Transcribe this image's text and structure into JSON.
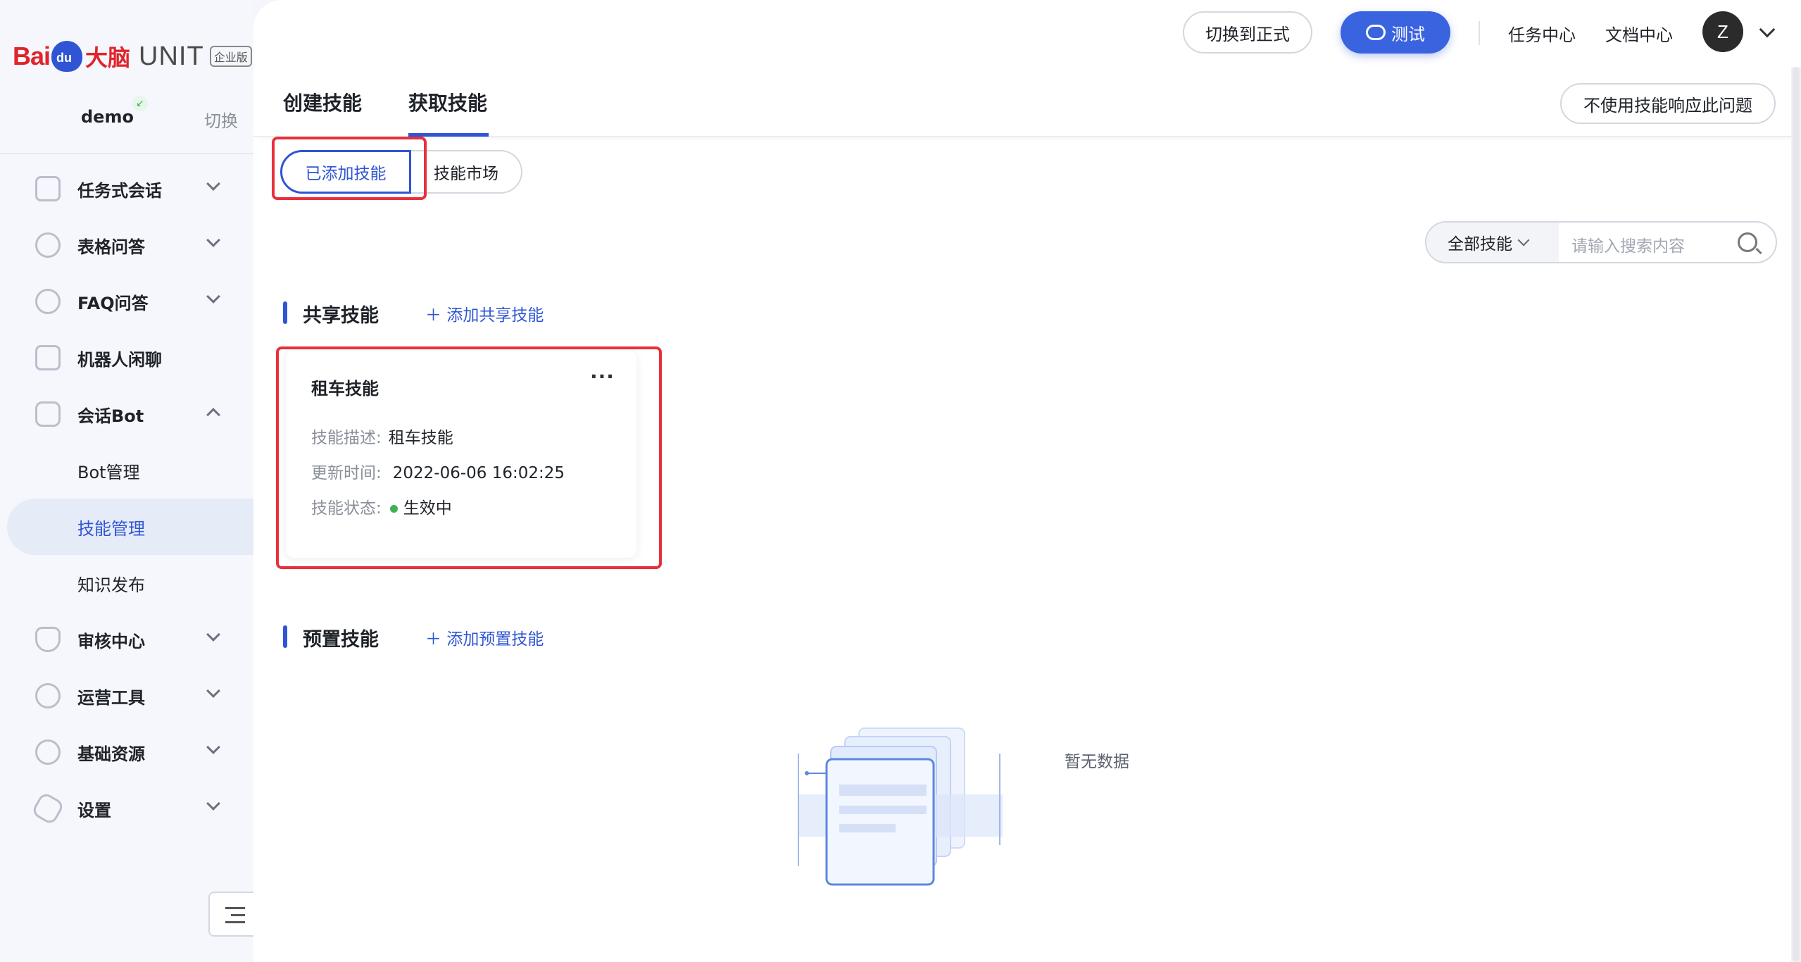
{
  "brand": {
    "baidu": "Bai",
    "paw": "du",
    "danao": "大脑",
    "unit": "UNIT",
    "edition": "企业版"
  },
  "bot": {
    "name": "demo",
    "switch": "切换"
  },
  "sidebar": {
    "items": [
      {
        "label": "任务式会话"
      },
      {
        "label": "表格问答"
      },
      {
        "label": "FAQ问答"
      },
      {
        "label": "机器人闲聊"
      },
      {
        "label": "会话Bot"
      },
      {
        "label": "Bot管理"
      },
      {
        "label": "技能管理"
      },
      {
        "label": "知识发布"
      },
      {
        "label": "审核中心"
      },
      {
        "label": "运营工具"
      },
      {
        "label": "基础资源"
      },
      {
        "label": "设置"
      }
    ]
  },
  "topbar": {
    "switch_prod": "切换到正式",
    "test": "测试",
    "task_center": "任务中心",
    "doc_center": "文档中心",
    "avatar": "Z"
  },
  "tabs": {
    "create": "创建技能",
    "get": "获取技能",
    "no_skill_btn": "不使用技能响应此问题"
  },
  "segment": {
    "added": "已添加技能",
    "market": "技能市场"
  },
  "filter": {
    "select": "全部技能",
    "placeholder": "请输入搜索内容"
  },
  "shared": {
    "title": "共享技能",
    "add": "添加共享技能"
  },
  "card": {
    "title": "租车技能",
    "more": "···",
    "desc_key": "技能描述:",
    "desc_val": "租车技能",
    "time_key": "更新时间:",
    "time_val": "2022-06-06 16:02:25",
    "status_key": "技能状态:",
    "status_val": "生效中"
  },
  "preset": {
    "title": "预置技能",
    "add": "添加预置技能",
    "empty": "暂无数据"
  },
  "colors": {
    "accent": "#2f55d4",
    "highlight": "#e8303a",
    "status_ok": "#3cb253"
  }
}
